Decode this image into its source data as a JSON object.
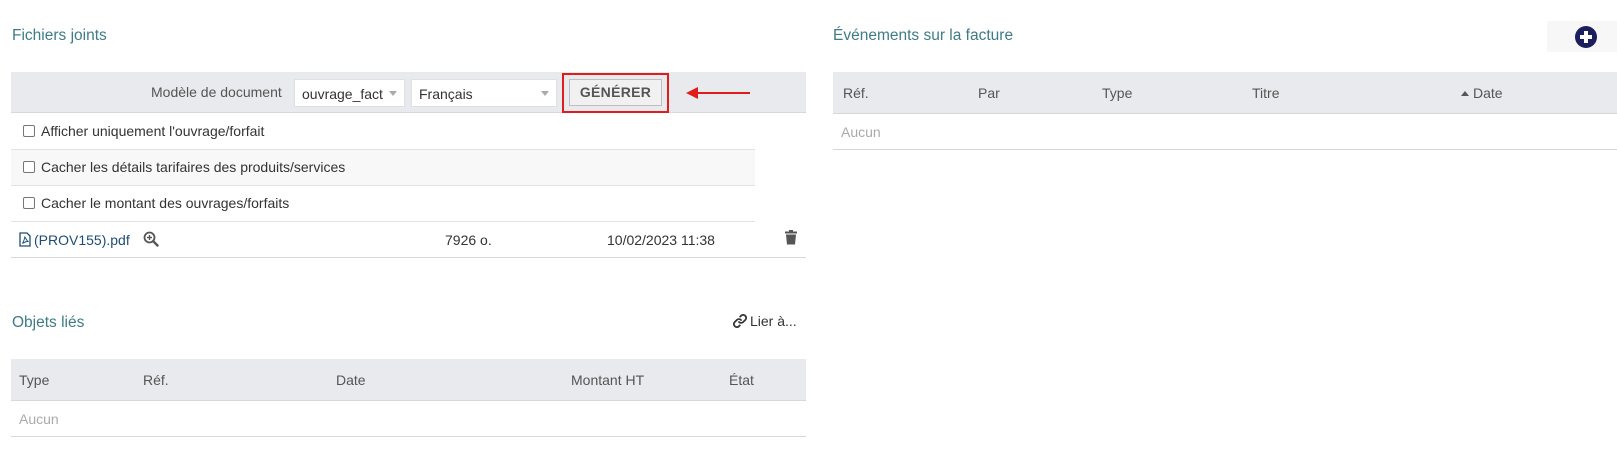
{
  "files": {
    "title": "Fichiers joints",
    "model_label": "Modèle de document",
    "model_value": "ouvrage_fact",
    "lang_value": "Français",
    "generate_label": "GÉNÉRER",
    "options": [
      "Afficher uniquement l'ouvrage/forfait",
      "Cacher les détails tarifaires des produits/services",
      "Cacher le montant des ouvrages/forfaits"
    ],
    "file": {
      "name": "(PROV155).pdf",
      "size": "7926 o.",
      "date": "10/02/2023 11:38"
    }
  },
  "linked": {
    "title": "Objets liés",
    "link_label": "Lier à...",
    "columns": [
      "Type",
      "Réf.",
      "Date",
      "Montant HT",
      "État"
    ],
    "empty": "Aucun"
  },
  "events": {
    "title": "Événements sur la facture",
    "columns": [
      "Réf.",
      "Par",
      "Type",
      "Titre",
      "Date"
    ],
    "empty": "Aucun"
  },
  "colors": {
    "accent": "#3e7c86",
    "highlight": "#e01c1c",
    "add_icon": "#1b1f5e"
  },
  "icons": [
    "pdf-icon",
    "zoom-icon",
    "trash-icon",
    "link-icon",
    "plus-circle-icon",
    "sort-up-icon",
    "arrow-left-icon"
  ]
}
